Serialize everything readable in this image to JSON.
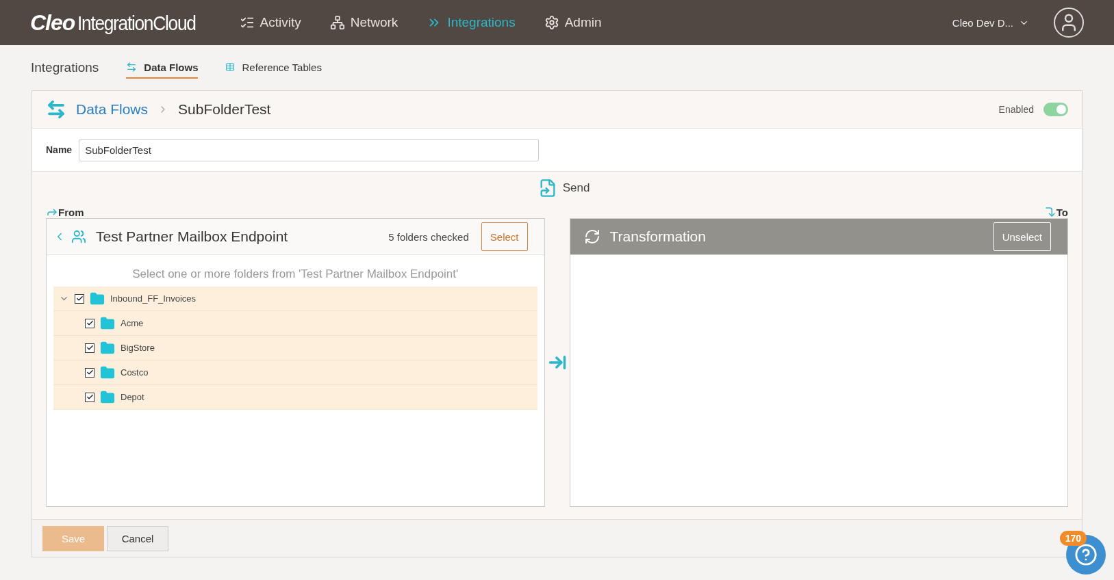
{
  "header": {
    "logo": {
      "brand": "Cleo",
      "product": "IntegrationCloud"
    },
    "nav": [
      {
        "label": "Activity",
        "selected": false
      },
      {
        "label": "Network",
        "selected": false
      },
      {
        "label": "Integrations",
        "selected": true
      },
      {
        "label": "Admin",
        "selected": false
      }
    ],
    "account": "Cleo Dev D..."
  },
  "subnav": {
    "title": "Integrations",
    "tabs": [
      {
        "label": "Data Flows",
        "selected": true
      },
      {
        "label": "Reference Tables",
        "selected": false
      }
    ]
  },
  "breadcrumb": {
    "parent": "Data Flows",
    "current": "SubFolderTest"
  },
  "enabled": {
    "label": "Enabled",
    "on": true
  },
  "name_field": {
    "label": "Name",
    "value": "SubFolderTest"
  },
  "action": "Send",
  "from": {
    "label": "From",
    "title": "Test Partner Mailbox Endpoint",
    "count": "5 folders checked",
    "button": "Select",
    "hint": "Select one or more folders from 'Test Partner Mailbox Endpoint'",
    "tree": [
      {
        "label": "Inbound_FF_Invoices",
        "checked": true,
        "expanded": true,
        "children": [
          {
            "label": "Acme",
            "checked": true
          },
          {
            "label": "BigStore",
            "checked": true
          },
          {
            "label": "Costco",
            "checked": true
          },
          {
            "label": "Depot",
            "checked": true
          }
        ]
      }
    ]
  },
  "to": {
    "label": "To",
    "title": "Transformation",
    "button": "Unselect"
  },
  "footer": {
    "buttons": [
      {
        "label": "Save",
        "kind": "primary",
        "disabled": true
      },
      {
        "label": "Cancel",
        "kind": "secondary",
        "disabled": false
      }
    ]
  },
  "help": {
    "badge": "170"
  }
}
